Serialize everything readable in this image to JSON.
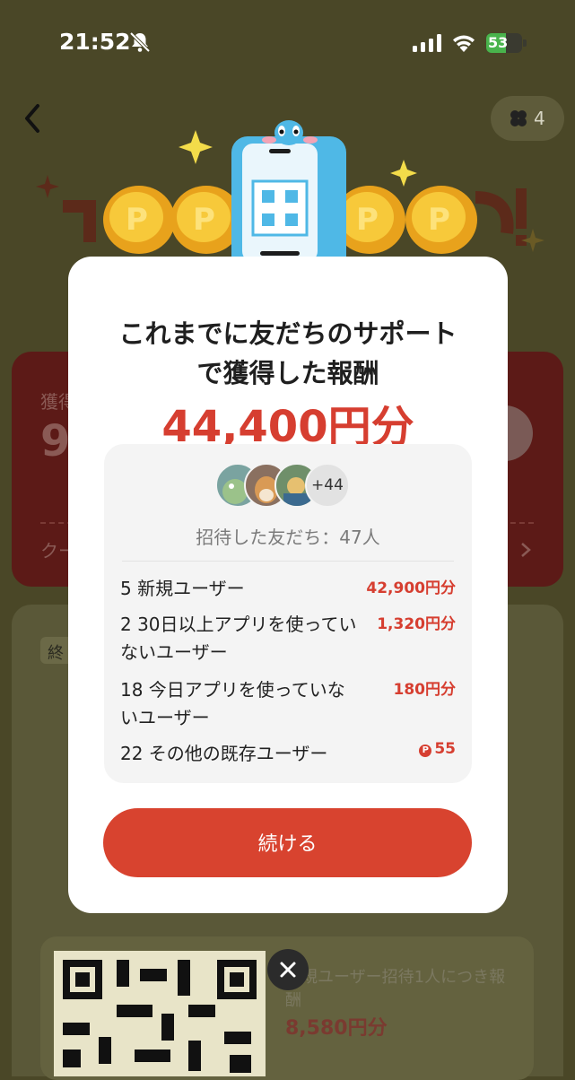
{
  "status_bar": {
    "time": "21:52",
    "battery": "53"
  },
  "header": {
    "coupon_count": "4"
  },
  "background": {
    "card_label": "獲得",
    "card_amount": "9",
    "card_link": "クー",
    "section_tag": "終",
    "qr_caption": "新規ユーザー招待1人につき報酬",
    "qr_reward": "8,580円分"
  },
  "modal": {
    "title_line1": "これまでに友だちのサポート",
    "title_line2": "で獲得した報酬",
    "total_amount": "44,400円分",
    "avatar_more": "+44",
    "invited_text": "招待した友だち：47人",
    "rows": [
      {
        "label": "5 新規ユーザー",
        "value": "42,900円分",
        "point": false
      },
      {
        "label": "2 30日以上アプリを使っていないユーザー",
        "value": "1,320円分",
        "point": false
      },
      {
        "label": "18 今日アプリを使っていないユーザー",
        "value": "180円分",
        "point": false
      },
      {
        "label": "22 その他の既存ユーザー",
        "value": "55",
        "point": true
      }
    ],
    "point_badge": "P",
    "continue_label": "続ける"
  },
  "colors": {
    "accent": "#d63e30",
    "button": "#d8432f",
    "overlay": "#4a4727"
  }
}
